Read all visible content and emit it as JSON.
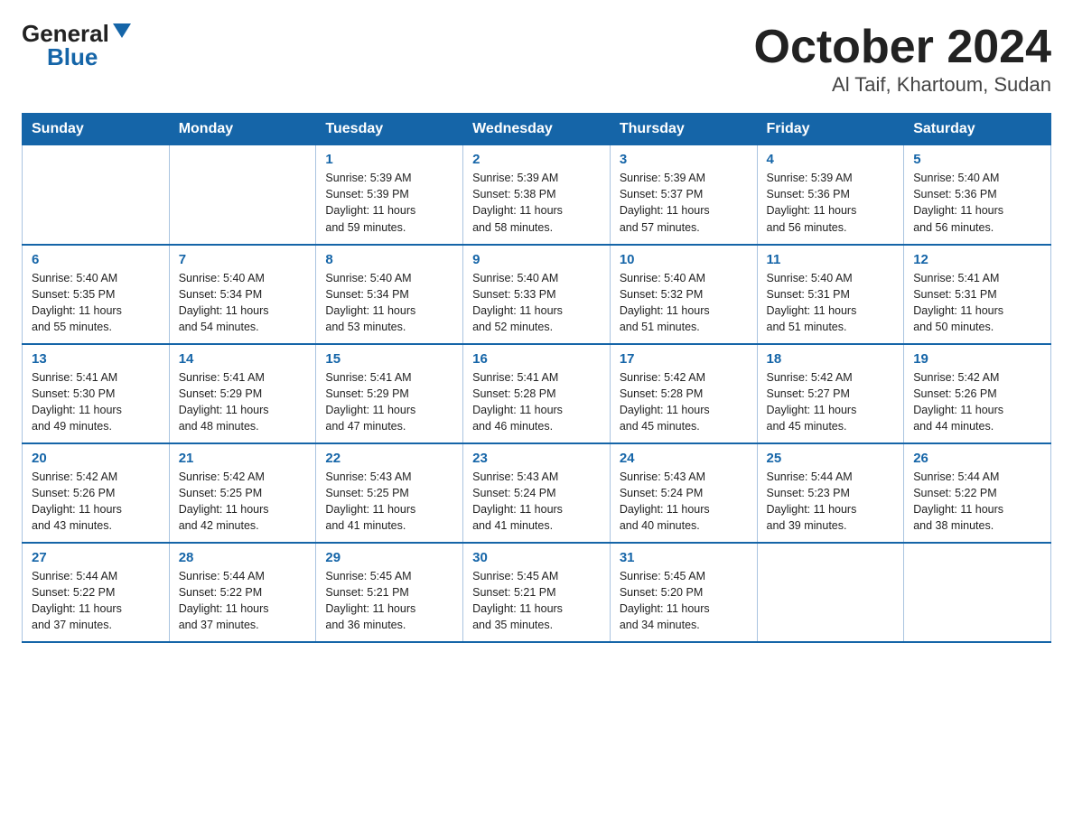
{
  "header": {
    "logo_general": "General",
    "logo_blue": "Blue",
    "title": "October 2024",
    "subtitle": "Al Taif, Khartoum, Sudan"
  },
  "days_of_week": [
    "Sunday",
    "Monday",
    "Tuesday",
    "Wednesday",
    "Thursday",
    "Friday",
    "Saturday"
  ],
  "weeks": [
    [
      {
        "day": "",
        "info": ""
      },
      {
        "day": "",
        "info": ""
      },
      {
        "day": "1",
        "info": "Sunrise: 5:39 AM\nSunset: 5:39 PM\nDaylight: 11 hours\nand 59 minutes."
      },
      {
        "day": "2",
        "info": "Sunrise: 5:39 AM\nSunset: 5:38 PM\nDaylight: 11 hours\nand 58 minutes."
      },
      {
        "day": "3",
        "info": "Sunrise: 5:39 AM\nSunset: 5:37 PM\nDaylight: 11 hours\nand 57 minutes."
      },
      {
        "day": "4",
        "info": "Sunrise: 5:39 AM\nSunset: 5:36 PM\nDaylight: 11 hours\nand 56 minutes."
      },
      {
        "day": "5",
        "info": "Sunrise: 5:40 AM\nSunset: 5:36 PM\nDaylight: 11 hours\nand 56 minutes."
      }
    ],
    [
      {
        "day": "6",
        "info": "Sunrise: 5:40 AM\nSunset: 5:35 PM\nDaylight: 11 hours\nand 55 minutes."
      },
      {
        "day": "7",
        "info": "Sunrise: 5:40 AM\nSunset: 5:34 PM\nDaylight: 11 hours\nand 54 minutes."
      },
      {
        "day": "8",
        "info": "Sunrise: 5:40 AM\nSunset: 5:34 PM\nDaylight: 11 hours\nand 53 minutes."
      },
      {
        "day": "9",
        "info": "Sunrise: 5:40 AM\nSunset: 5:33 PM\nDaylight: 11 hours\nand 52 minutes."
      },
      {
        "day": "10",
        "info": "Sunrise: 5:40 AM\nSunset: 5:32 PM\nDaylight: 11 hours\nand 51 minutes."
      },
      {
        "day": "11",
        "info": "Sunrise: 5:40 AM\nSunset: 5:31 PM\nDaylight: 11 hours\nand 51 minutes."
      },
      {
        "day": "12",
        "info": "Sunrise: 5:41 AM\nSunset: 5:31 PM\nDaylight: 11 hours\nand 50 minutes."
      }
    ],
    [
      {
        "day": "13",
        "info": "Sunrise: 5:41 AM\nSunset: 5:30 PM\nDaylight: 11 hours\nand 49 minutes."
      },
      {
        "day": "14",
        "info": "Sunrise: 5:41 AM\nSunset: 5:29 PM\nDaylight: 11 hours\nand 48 minutes."
      },
      {
        "day": "15",
        "info": "Sunrise: 5:41 AM\nSunset: 5:29 PM\nDaylight: 11 hours\nand 47 minutes."
      },
      {
        "day": "16",
        "info": "Sunrise: 5:41 AM\nSunset: 5:28 PM\nDaylight: 11 hours\nand 46 minutes."
      },
      {
        "day": "17",
        "info": "Sunrise: 5:42 AM\nSunset: 5:28 PM\nDaylight: 11 hours\nand 45 minutes."
      },
      {
        "day": "18",
        "info": "Sunrise: 5:42 AM\nSunset: 5:27 PM\nDaylight: 11 hours\nand 45 minutes."
      },
      {
        "day": "19",
        "info": "Sunrise: 5:42 AM\nSunset: 5:26 PM\nDaylight: 11 hours\nand 44 minutes."
      }
    ],
    [
      {
        "day": "20",
        "info": "Sunrise: 5:42 AM\nSunset: 5:26 PM\nDaylight: 11 hours\nand 43 minutes."
      },
      {
        "day": "21",
        "info": "Sunrise: 5:42 AM\nSunset: 5:25 PM\nDaylight: 11 hours\nand 42 minutes."
      },
      {
        "day": "22",
        "info": "Sunrise: 5:43 AM\nSunset: 5:25 PM\nDaylight: 11 hours\nand 41 minutes."
      },
      {
        "day": "23",
        "info": "Sunrise: 5:43 AM\nSunset: 5:24 PM\nDaylight: 11 hours\nand 41 minutes."
      },
      {
        "day": "24",
        "info": "Sunrise: 5:43 AM\nSunset: 5:24 PM\nDaylight: 11 hours\nand 40 minutes."
      },
      {
        "day": "25",
        "info": "Sunrise: 5:44 AM\nSunset: 5:23 PM\nDaylight: 11 hours\nand 39 minutes."
      },
      {
        "day": "26",
        "info": "Sunrise: 5:44 AM\nSunset: 5:22 PM\nDaylight: 11 hours\nand 38 minutes."
      }
    ],
    [
      {
        "day": "27",
        "info": "Sunrise: 5:44 AM\nSunset: 5:22 PM\nDaylight: 11 hours\nand 37 minutes."
      },
      {
        "day": "28",
        "info": "Sunrise: 5:44 AM\nSunset: 5:22 PM\nDaylight: 11 hours\nand 37 minutes."
      },
      {
        "day": "29",
        "info": "Sunrise: 5:45 AM\nSunset: 5:21 PM\nDaylight: 11 hours\nand 36 minutes."
      },
      {
        "day": "30",
        "info": "Sunrise: 5:45 AM\nSunset: 5:21 PM\nDaylight: 11 hours\nand 35 minutes."
      },
      {
        "day": "31",
        "info": "Sunrise: 5:45 AM\nSunset: 5:20 PM\nDaylight: 11 hours\nand 34 minutes."
      },
      {
        "day": "",
        "info": ""
      },
      {
        "day": "",
        "info": ""
      }
    ]
  ]
}
